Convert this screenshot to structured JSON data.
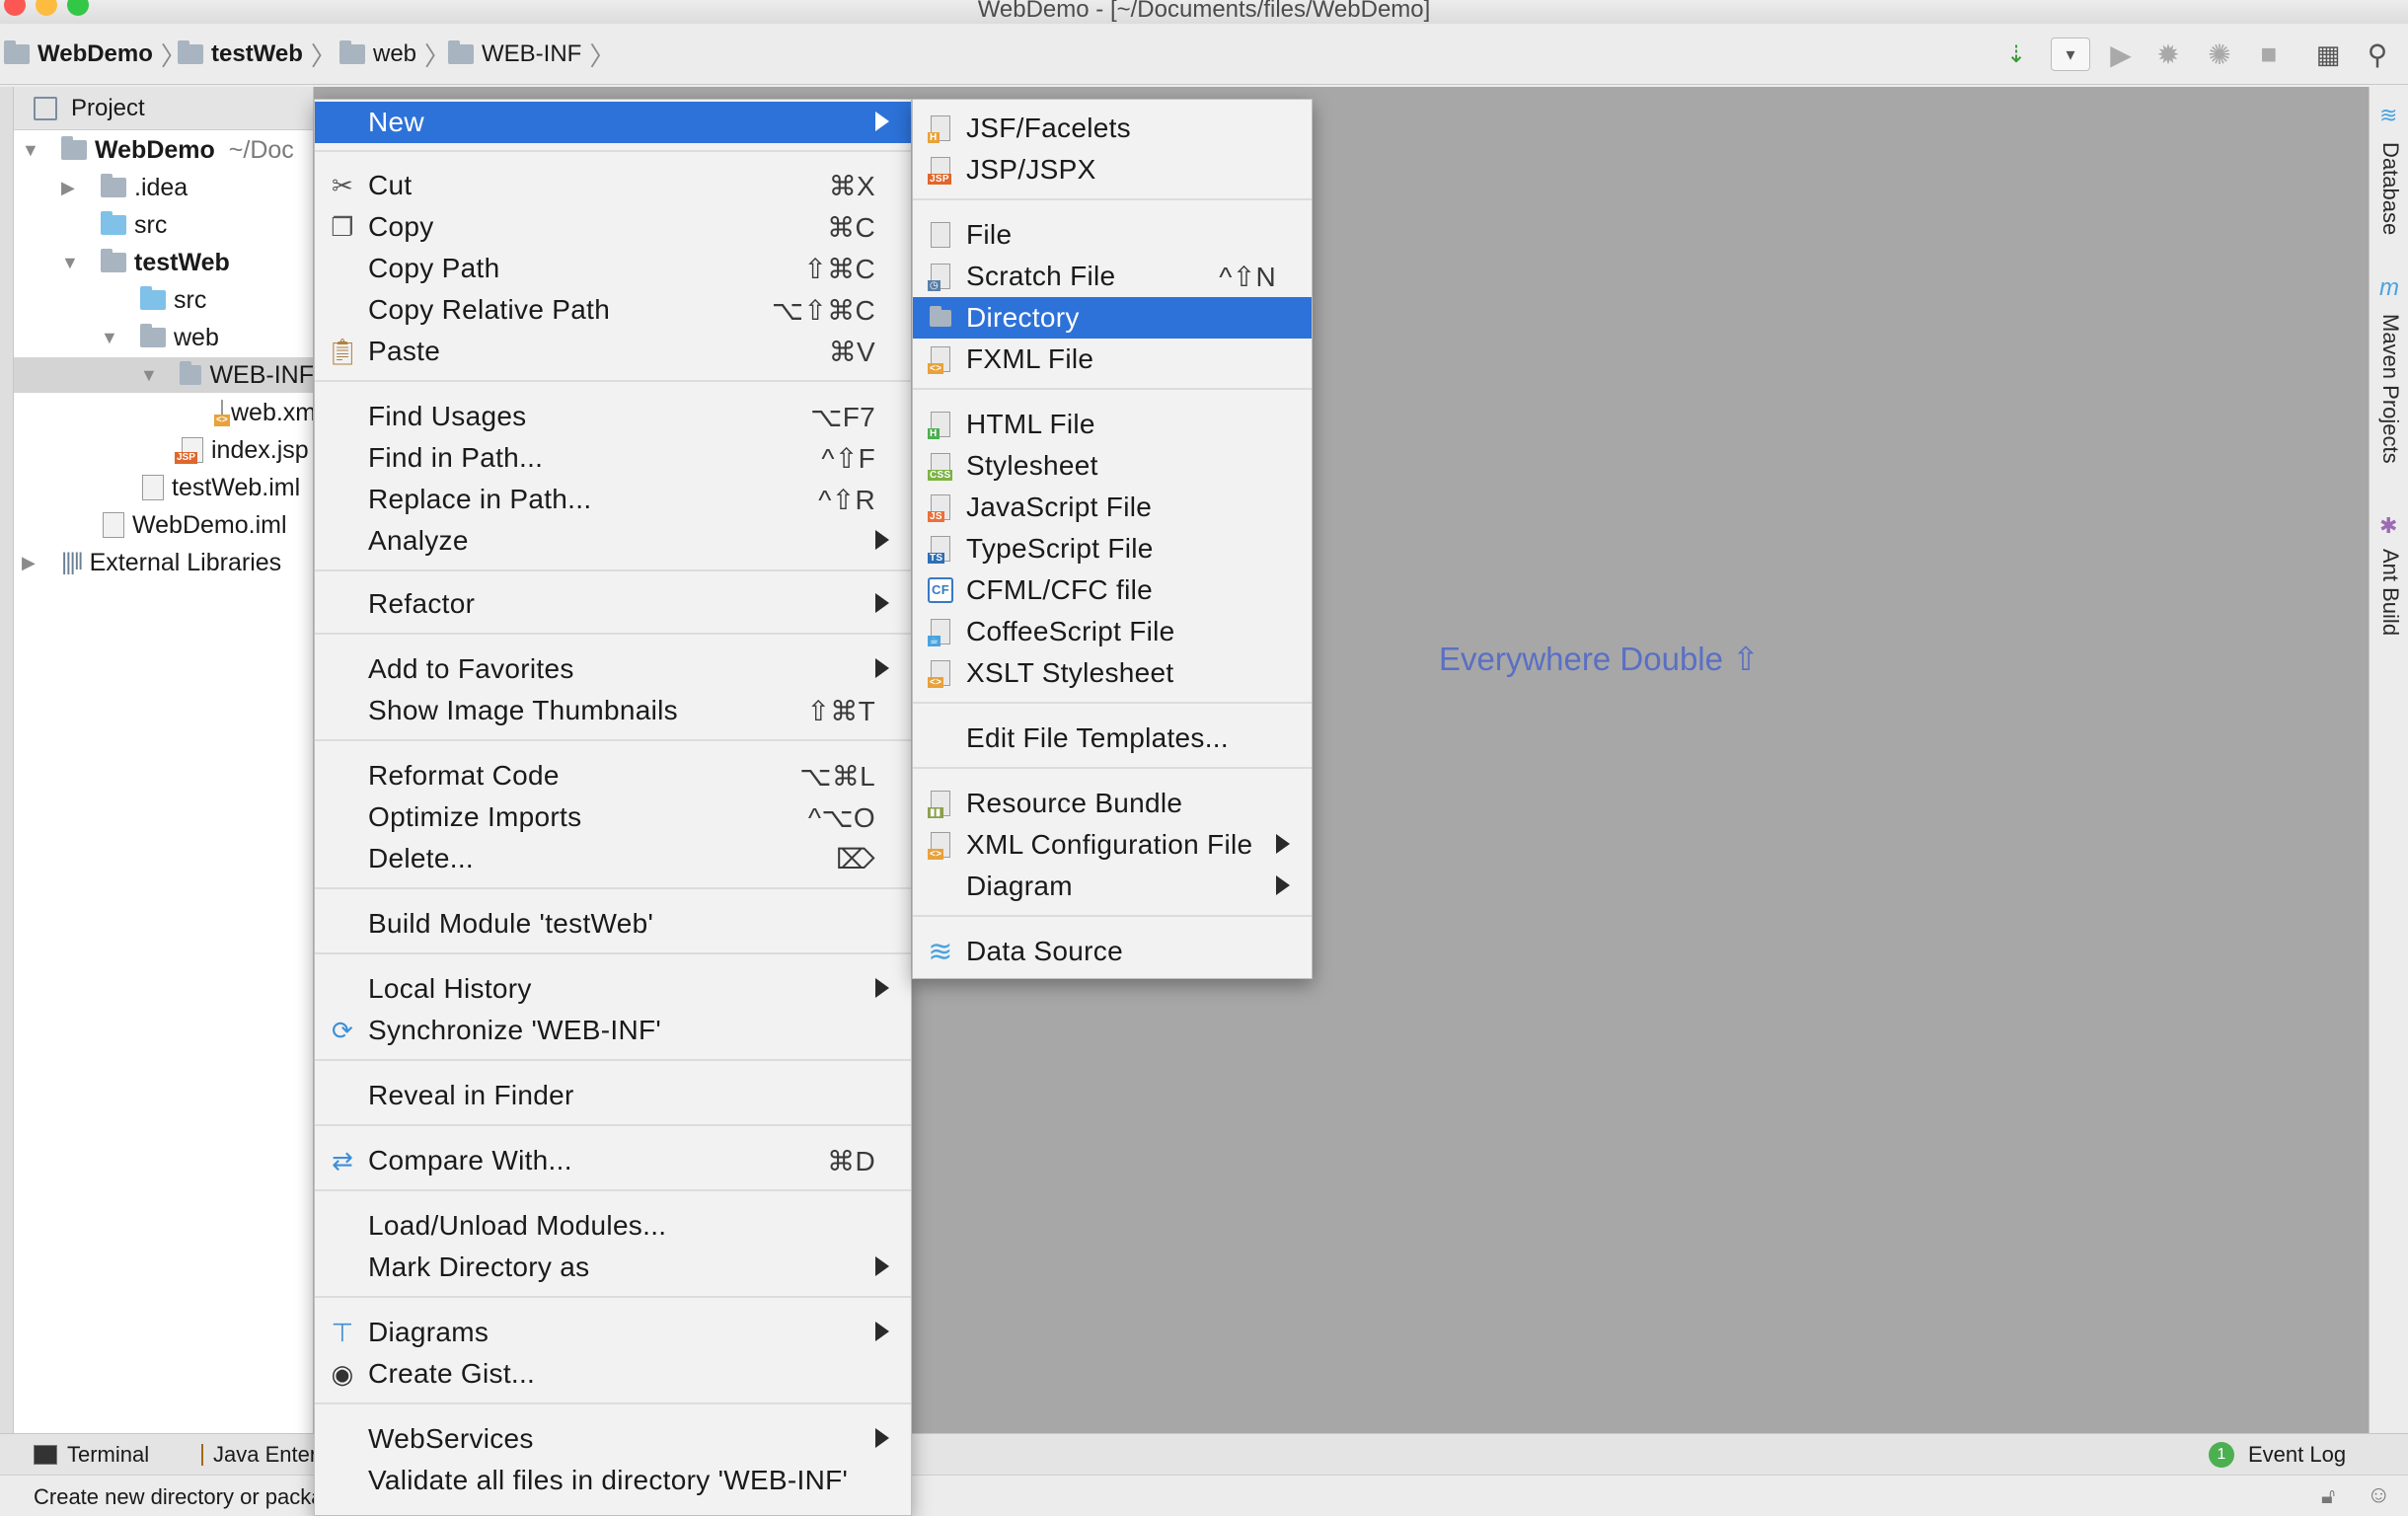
{
  "window": {
    "title": "WebDemo - [~/Documents/files/WebDemo]"
  },
  "breadcrumbs": [
    {
      "label": "WebDemo",
      "bold": true
    },
    {
      "label": "testWeb",
      "bold": true
    },
    {
      "label": "web",
      "bold": false
    },
    {
      "label": "WEB-INF",
      "bold": false
    }
  ],
  "project_panel": {
    "title": "Project",
    "tree": [
      {
        "label": "WebDemo",
        "suffix": "~/Doc",
        "level": 0,
        "expanded": true,
        "icon": "module-folder-icon",
        "bold": true
      },
      {
        "label": ".idea",
        "level": 1,
        "expanded": false,
        "icon": "folder-icon"
      },
      {
        "label": "src",
        "level": 1,
        "icon": "source-folder-icon"
      },
      {
        "label": "testWeb",
        "level": 1,
        "expanded": true,
        "icon": "module-folder-icon",
        "bold": true
      },
      {
        "label": "src",
        "level": 2,
        "icon": "source-folder-icon"
      },
      {
        "label": "web",
        "level": 2,
        "expanded": true,
        "icon": "web-folder-icon"
      },
      {
        "label": "WEB-INF",
        "level": 3,
        "expanded": true,
        "icon": "folder-icon",
        "selected": true
      },
      {
        "label": "web.xml",
        "level": 4,
        "icon": "xml-file-icon"
      },
      {
        "label": "index.jsp",
        "level": 3,
        "icon": "jsp-file-icon"
      },
      {
        "label": "testWeb.iml",
        "level": 2,
        "icon": "iml-file-icon"
      },
      {
        "label": "WebDemo.iml",
        "level": 1,
        "icon": "iml-file-icon"
      },
      {
        "label": "External Libraries",
        "level": 0,
        "expanded": false,
        "icon": "library-icon"
      }
    ]
  },
  "editor": {
    "hint": "Everywhere Double ⇧"
  },
  "right_tabs": [
    "Database",
    "Maven Projects",
    "Ant Build"
  ],
  "bottom_tabs": {
    "terminal": "Terminal",
    "java_enterprise": "Java Enterprise",
    "event_log": "Event Log",
    "event_count": "1"
  },
  "status": {
    "text": "Create new directory or package"
  },
  "context_menu": {
    "items": [
      {
        "label": "New",
        "submenu": true,
        "highlighted": true
      },
      {
        "sep": true
      },
      {
        "label": "Cut",
        "shortcut": "⌘X",
        "icon": "scissors-icon"
      },
      {
        "label": "Copy",
        "shortcut": "⌘C",
        "icon": "copy-icon"
      },
      {
        "label": "Copy Path",
        "shortcut": "⇧⌘C"
      },
      {
        "label": "Copy Relative Path",
        "shortcut": "⌥⇧⌘C"
      },
      {
        "label": "Paste",
        "shortcut": "⌘V",
        "icon": "paste-icon"
      },
      {
        "sep": true
      },
      {
        "label": "Find Usages",
        "shortcut": "⌥F7"
      },
      {
        "label": "Find in Path...",
        "shortcut": "^⇧F"
      },
      {
        "label": "Replace in Path...",
        "shortcut": "^⇧R"
      },
      {
        "label": "Analyze",
        "submenu": true
      },
      {
        "sep": true
      },
      {
        "label": "Refactor",
        "submenu": true
      },
      {
        "sep": true
      },
      {
        "label": "Add to Favorites",
        "submenu": true
      },
      {
        "label": "Show Image Thumbnails",
        "shortcut": "⇧⌘T"
      },
      {
        "sep": true
      },
      {
        "label": "Reformat Code",
        "shortcut": "⌥⌘L"
      },
      {
        "label": "Optimize Imports",
        "shortcut": "^⌥O"
      },
      {
        "label": "Delete...",
        "shortcut": "⌦"
      },
      {
        "sep": true
      },
      {
        "label": "Build Module 'testWeb'"
      },
      {
        "sep": true
      },
      {
        "label": "Local History",
        "submenu": true
      },
      {
        "label": "Synchronize 'WEB-INF'",
        "icon": "sync-icon"
      },
      {
        "sep": true
      },
      {
        "label": "Reveal in Finder"
      },
      {
        "sep": true
      },
      {
        "label": "Compare With...",
        "shortcut": "⌘D",
        "icon": "compare-icon"
      },
      {
        "sep": true
      },
      {
        "label": "Load/Unload Modules..."
      },
      {
        "label": "Mark Directory as",
        "submenu": true
      },
      {
        "sep": true
      },
      {
        "label": "Diagrams",
        "submenu": true,
        "icon": "diagram-icon"
      },
      {
        "label": "Create Gist...",
        "icon": "github-icon"
      },
      {
        "sep": true
      },
      {
        "label": "WebServices",
        "submenu": true
      },
      {
        "label": "Validate all files in directory 'WEB-INF'"
      }
    ]
  },
  "new_submenu": {
    "items": [
      {
        "label": "JSF/Facelets",
        "icon": "jsf-file-icon",
        "badge": "H",
        "badge_color": "#e8a23a"
      },
      {
        "label": "JSP/JSPX",
        "icon": "jsp-file-icon",
        "badge": "JSP",
        "badge_color": "#e0662c"
      },
      {
        "sep": true
      },
      {
        "label": "File",
        "icon": "text-file-icon"
      },
      {
        "label": "Scratch File",
        "shortcut": "^⇧N",
        "icon": "scratch-file-icon"
      },
      {
        "label": "Directory",
        "icon": "folder-icon",
        "highlighted": true
      },
      {
        "label": "FXML File",
        "icon": "fxml-file-icon",
        "badge": "<>",
        "badge_color": "#e8a23a"
      },
      {
        "sep": true
      },
      {
        "label": "HTML File",
        "icon": "html-file-icon",
        "badge": "H",
        "badge_color": "#4caf50"
      },
      {
        "label": "Stylesheet",
        "icon": "css-file-icon",
        "badge": "CSS",
        "badge_color": "#7cb342"
      },
      {
        "label": "JavaScript File",
        "icon": "js-file-icon",
        "badge": "JS",
        "badge_color": "#e8703a"
      },
      {
        "label": "TypeScript File",
        "icon": "ts-file-icon",
        "badge": "TS",
        "badge_color": "#2f6fb5"
      },
      {
        "label": "CFML/CFC file",
        "icon": "cfml-file-icon",
        "badge": "CF",
        "badge_color": "#3a78c2"
      },
      {
        "label": "CoffeeScript File",
        "icon": "coffeescript-file-icon",
        "badge": "☕",
        "badge_color": "#4aa3df"
      },
      {
        "label": "XSLT Stylesheet",
        "icon": "xslt-file-icon",
        "badge": "<>",
        "badge_color": "#e8a23a"
      },
      {
        "sep": true
      },
      {
        "label": "Edit File Templates..."
      },
      {
        "sep": true
      },
      {
        "label": "Resource Bundle",
        "icon": "resource-bundle-icon",
        "badge": "▮",
        "badge_color": "#8aa04a"
      },
      {
        "label": "XML Configuration File",
        "icon": "xml-file-icon",
        "submenu": true,
        "badge": "<>",
        "badge_color": "#e8a23a"
      },
      {
        "label": "Diagram",
        "submenu": true
      },
      {
        "sep": true
      },
      {
        "label": "Data Source",
        "icon": "database-icon"
      }
    ]
  },
  "colors": {
    "highlight": "#2d72d9",
    "editor_bg": "#a7a7a7",
    "menu_bg": "#f2f2f2"
  }
}
